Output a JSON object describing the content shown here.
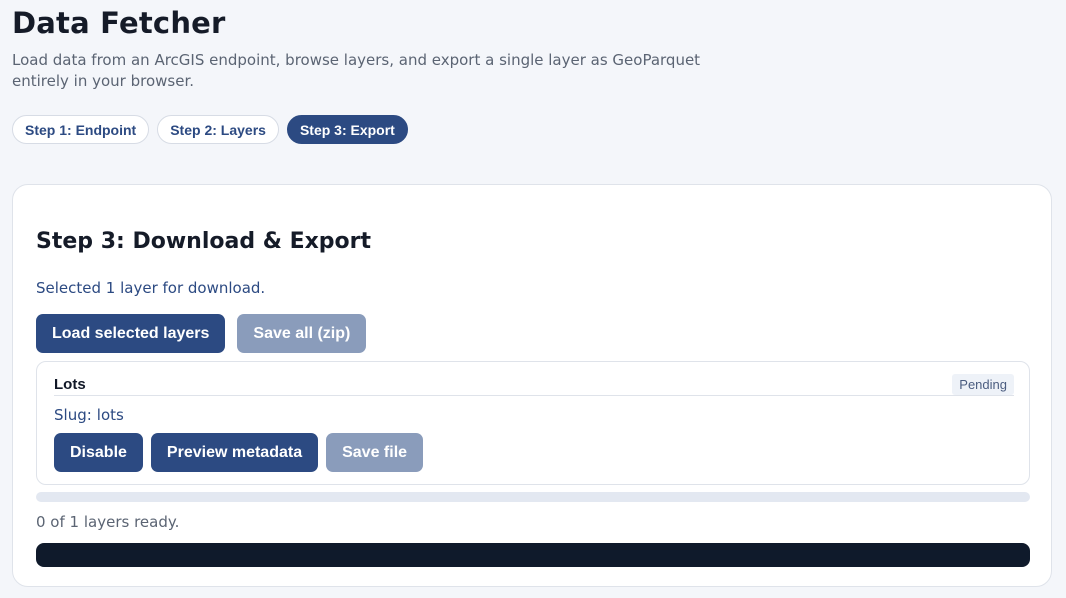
{
  "header": {
    "title": "Data Fetcher",
    "subtitle": "Load data from an ArcGIS endpoint, browse layers, and export a single layer as GeoParquet entirely in your browser."
  },
  "steps": [
    {
      "label": "Step 1: Endpoint",
      "active": false
    },
    {
      "label": "Step 2: Layers",
      "active": false
    },
    {
      "label": "Step 3: Export",
      "active": true
    }
  ],
  "export": {
    "title": "Step 3: Download & Export",
    "selected_message": "Selected 1 layer for download.",
    "load_button": "Load selected layers",
    "save_all_button": "Save all (zip)",
    "layer": {
      "name": "Lots",
      "status": "Pending",
      "slug_label": "Slug:",
      "slug_value": "lots",
      "disable_button": "Disable",
      "preview_button": "Preview metadata",
      "save_button": "Save file"
    },
    "progress": 0,
    "ready_message": "0 of 1 layers ready."
  },
  "colors": {
    "accent": "#2c4a82",
    "disabled": "#8a9cbb",
    "log_background": "#0f1a2b"
  }
}
